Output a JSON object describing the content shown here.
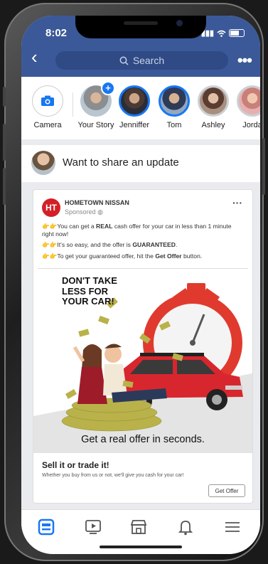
{
  "status": {
    "time": "8:02"
  },
  "search": {
    "placeholder": "Search"
  },
  "stories": [
    {
      "label": "Camera"
    },
    {
      "label": "Your Story"
    },
    {
      "label": "Jenniffer"
    },
    {
      "label": "Tom"
    },
    {
      "label": "Ashley"
    },
    {
      "label": "Jorda"
    }
  ],
  "composer": {
    "text": "Want to share an update"
  },
  "post": {
    "logo_text": "HT",
    "page_name": "HOMETOWN NISSAN",
    "sponsored": "Sponsored",
    "lines": [
      {
        "a": "You can get a ",
        "b": "REAL",
        "c": " cash offer for your car in less than 1 minute right now!"
      },
      {
        "a": "It's so easy, and the offer is ",
        "b": "GUARANTEED",
        "c": "."
      },
      {
        "a": "To get your guaranteed offer, hit the ",
        "b": "Get Offer",
        "c": " button."
      }
    ],
    "headline": [
      "DON'T TAKE",
      "LESS FOR",
      "YOUR CAR!"
    ],
    "tagline": "Get a real offer in seconds.",
    "card_title": "Sell it or trade it!",
    "card_sub": "Whether you buy from us or not, we'll give you cash for your car!",
    "cta_label": "Get Offer"
  },
  "colors": {
    "brand": "#3b5998",
    "logo": "#d32027",
    "active_nav": "#1877f2"
  },
  "icons": [
    "back-arrow-icon",
    "search-icon",
    "more-icon",
    "camera-icon",
    "add-story-icon",
    "globe-icon",
    "news-feed-icon",
    "watch-icon",
    "marketplace-icon",
    "bell-icon",
    "menu-icon"
  ]
}
